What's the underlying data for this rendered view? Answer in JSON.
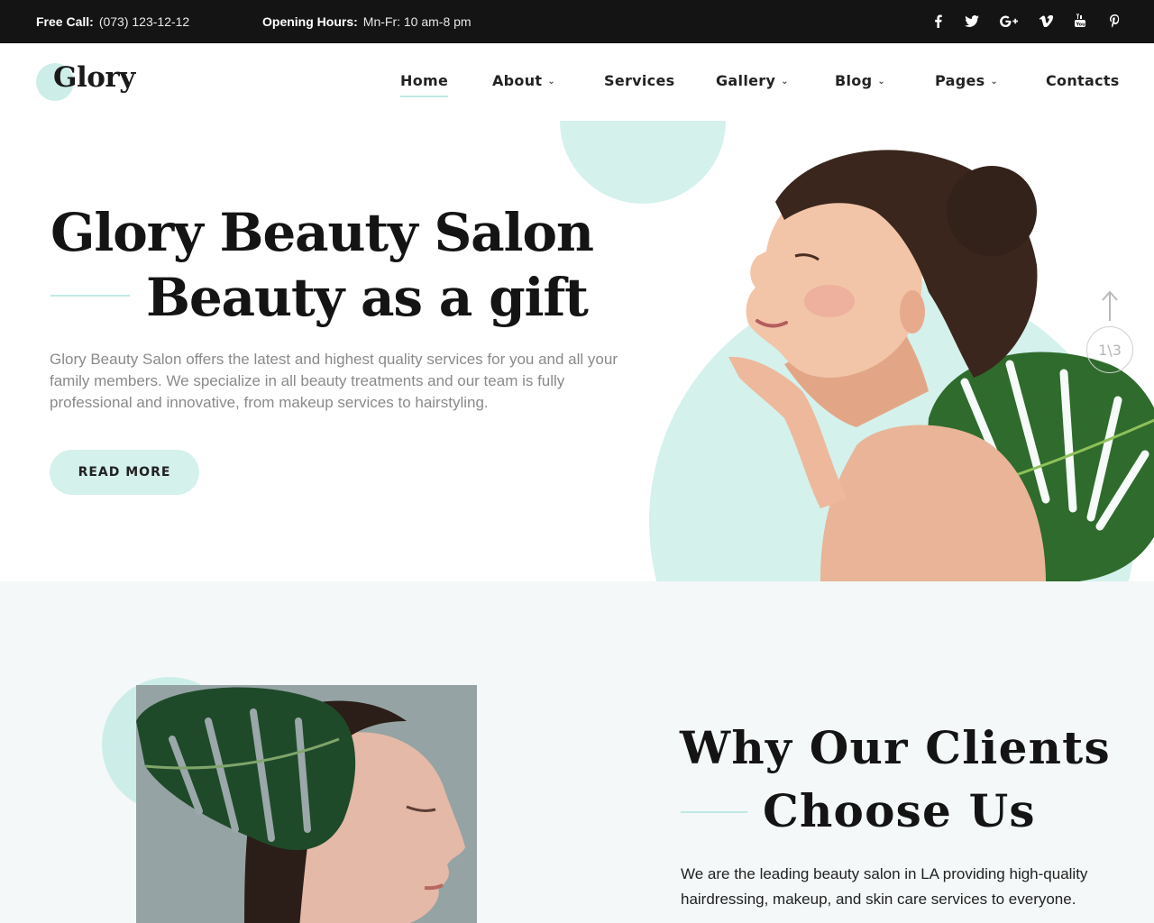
{
  "topbar": {
    "call_label": "Free Call:",
    "call_value": "(073) 123-12-12",
    "hours_label": "Opening Hours:",
    "hours_value": "Mn-Fr: 10 am-8 pm",
    "social": [
      {
        "icon": "facebook-icon",
        "glyph": "f"
      },
      {
        "icon": "twitter-icon",
        "glyph": "t"
      },
      {
        "icon": "google-plus-icon",
        "glyph": "G+"
      },
      {
        "icon": "vimeo-icon",
        "glyph": "v"
      },
      {
        "icon": "youtube-icon",
        "glyph": "▶"
      },
      {
        "icon": "pinterest-icon",
        "glyph": "p"
      }
    ]
  },
  "header": {
    "logo": "Glory",
    "nav": [
      {
        "label": "Home",
        "active": true,
        "dropdown": false
      },
      {
        "label": "About",
        "active": false,
        "dropdown": true
      },
      {
        "label": "Services",
        "active": false,
        "dropdown": false
      },
      {
        "label": "Gallery",
        "active": false,
        "dropdown": true
      },
      {
        "label": "Blog",
        "active": false,
        "dropdown": true
      },
      {
        "label": "Pages",
        "active": false,
        "dropdown": true
      },
      {
        "label": "Contacts",
        "active": false,
        "dropdown": false
      }
    ]
  },
  "hero": {
    "title_line1": "Glory Beauty Salon",
    "title_line2": "Beauty as a gift",
    "description": "Glory Beauty Salon offers the latest and highest quality services for you and all your family members. We specialize in all beauty treatments and our team is fully professional and innovative, from makeup services to hairstyling.",
    "button": "READ MORE",
    "slide_counter": "1\\3"
  },
  "why": {
    "title_line1": "Why Our Clients",
    "title_line2": "Choose Us",
    "description": "We are the leading beauty salon in LA providing high-quality hairdressing, makeup, and skin care services to everyone."
  },
  "colors": {
    "accent_mint": "#d4f1ec",
    "topbar_bg": "#141414",
    "section_bg": "#f4f8f8"
  }
}
